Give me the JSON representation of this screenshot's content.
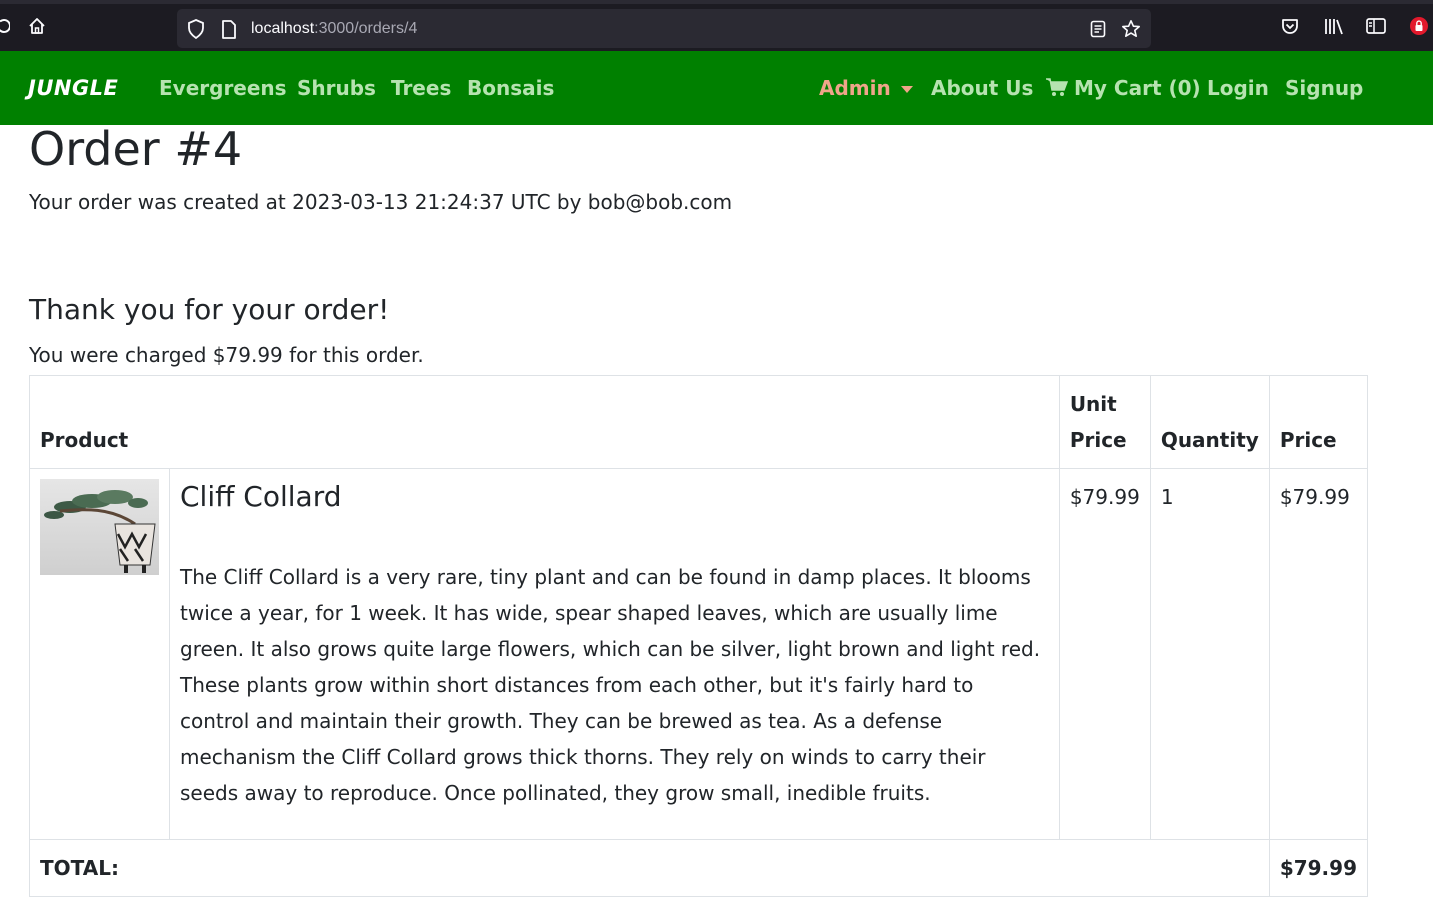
{
  "browser": {
    "url_host": "localhost",
    "url_path": ":3000/orders/4"
  },
  "navbar": {
    "brand": "JUNGLE",
    "links_left": [
      "Evergreens",
      "Shrubs",
      "Trees",
      "Bonsais"
    ],
    "admin": "Admin",
    "about": "About Us",
    "cart": "My Cart (0)",
    "login": "Login",
    "signup": "Signup"
  },
  "order": {
    "title": "Order #4",
    "created_text": "Your order was created at 2023-03-13 21:24:37 UTC by bob@bob.com",
    "thanks": "Thank you for your order!",
    "charged_text": "You were charged $79.99 for this order."
  },
  "table": {
    "headers": {
      "product": "Product",
      "unit_price": "Unit Price",
      "quantity": "Quantity",
      "price": "Price"
    },
    "items": [
      {
        "name": "Cliff Collard",
        "description": "The Cliff Collard is a very rare, tiny plant and can be found in damp places. It blooms twice a year, for 1 week. It has wide, spear shaped leaves, which are usually lime green. It also grows quite large flowers, which can be silver, light brown and light red. These plants grow within short distances from each other, but it's fairly hard to control and maintain their growth. They can be brewed as tea. As a defense mechanism the Cliff Collard grows thick thorns. They rely on winds to carry their seeds away to reproduce. Once pollinated, they grow small, inedible fruits.",
        "unit_price": "$79.99",
        "quantity": "1",
        "price": "$79.99"
      }
    ],
    "total_label": "TOTAL:",
    "total_value": "$79.99"
  },
  "colors": {
    "navbar_bg": "#008000",
    "nav_link": "#b6e3b0",
    "admin_link": "#f0a58a",
    "browser_bg": "#1c1b22"
  }
}
